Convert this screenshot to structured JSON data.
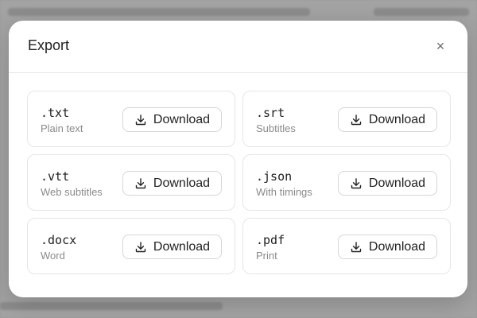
{
  "modal": {
    "title": "Export",
    "close_label": "×"
  },
  "exports": [
    {
      "ext": ".txt",
      "desc": "Plain text",
      "button": "Download"
    },
    {
      "ext": ".srt",
      "desc": "Subtitles",
      "button": "Download"
    },
    {
      "ext": ".vtt",
      "desc": "Web subtitles",
      "button": "Download"
    },
    {
      "ext": ".json",
      "desc": "With timings",
      "button": "Download"
    },
    {
      "ext": ".docx",
      "desc": "Word",
      "button": "Download"
    },
    {
      "ext": ".pdf",
      "desc": "Print",
      "button": "Download"
    }
  ],
  "icons": {
    "download": "download-icon",
    "close": "close-icon"
  },
  "colors": {
    "modal_bg": "#ffffff",
    "overlay": "#9a9a9a",
    "border": "#e6e6e6",
    "muted_text": "#8a8a8a"
  }
}
